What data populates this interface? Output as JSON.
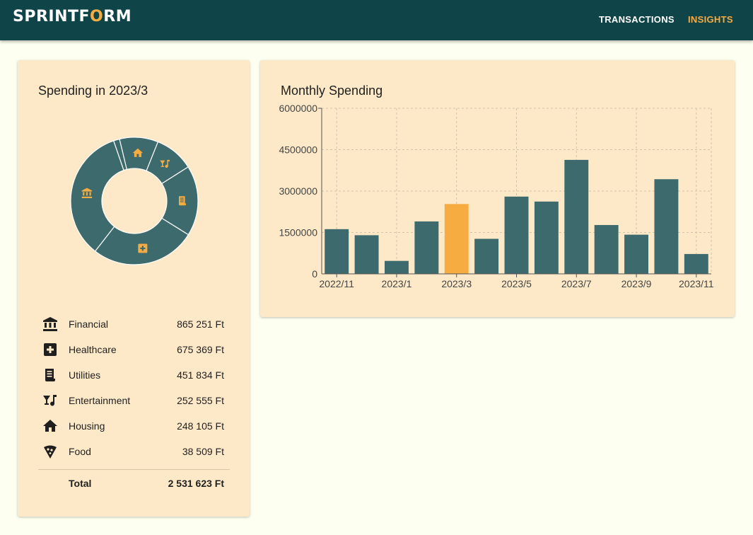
{
  "header": {
    "logo": {
      "before": "SPRINTF",
      "o": "O",
      "after": "RM"
    },
    "nav": {
      "transactions": "TRANSACTIONS",
      "insights": "INSIGHTS"
    }
  },
  "colors": {
    "brand": "#0f4448",
    "accent": "#f7ac41",
    "slice": "#3d6a6c",
    "card": "#fde9c8",
    "background": "#fdfff0"
  },
  "spending": {
    "title": "Spending in 2023/3",
    "items": [
      {
        "name": "Financial",
        "value": "865 251 Ft",
        "amount": 865251,
        "icon": "bank-icon"
      },
      {
        "name": "Healthcare",
        "value": "675 369 Ft",
        "amount": 675369,
        "icon": "medical-icon"
      },
      {
        "name": "Utilities",
        "value": "451 834 Ft",
        "amount": 451834,
        "icon": "receipt-icon"
      },
      {
        "name": "Entertainment",
        "value": "252 555 Ft",
        "amount": 252555,
        "icon": "cocktail-music-icon"
      },
      {
        "name": "Housing",
        "value": "248 105 Ft",
        "amount": 248105,
        "icon": "house-icon"
      },
      {
        "name": "Food",
        "value": "38 509 Ft",
        "amount": 38509,
        "icon": "pizza-icon"
      }
    ],
    "total_label": "Total",
    "total_value": "2 531 623 Ft"
  },
  "chart_data": {
    "type": "bar",
    "title": "Monthly Spending",
    "categories": [
      "2022/11",
      "2022/12",
      "2023/1",
      "2023/2",
      "2023/3",
      "2023/4",
      "2023/5",
      "2023/6",
      "2023/7",
      "2023/8",
      "2023/9",
      "2023/10",
      "2023/11"
    ],
    "values": [
      1620000,
      1400000,
      470000,
      1900000,
      2531623,
      1270000,
      2800000,
      2620000,
      4130000,
      1770000,
      1420000,
      3430000,
      720000
    ],
    "highlight_index": 4,
    "x_tick_labels": [
      "2022/11",
      "2023/1",
      "2023/3",
      "2023/5",
      "2023/7",
      "2023/9",
      "2023/11"
    ],
    "y_ticks": [
      0,
      1500000,
      3000000,
      4500000,
      6000000
    ],
    "y_tick_labels": [
      "0",
      "1500000",
      "3000000",
      "4500000",
      "6000000"
    ],
    "ylim": [
      0,
      6000000
    ],
    "grid": true,
    "xlabel": "",
    "ylabel": ""
  }
}
